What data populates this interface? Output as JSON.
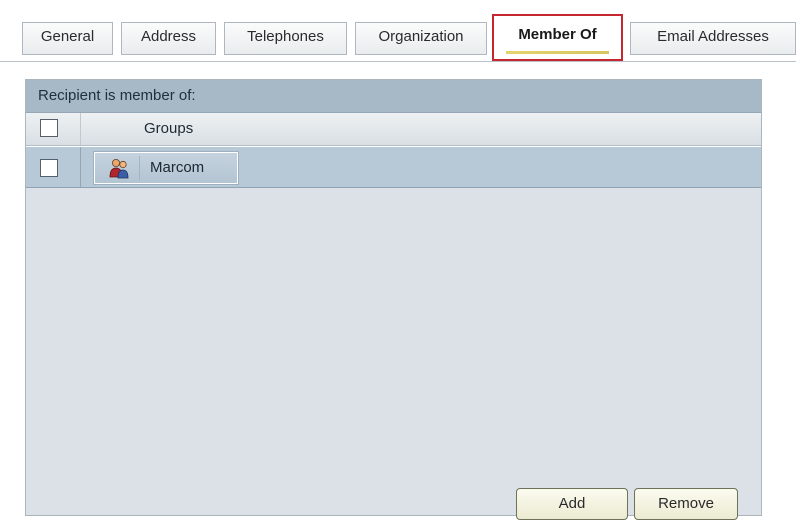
{
  "tabs": [
    {
      "label": "General",
      "active": false
    },
    {
      "label": "Address",
      "active": false
    },
    {
      "label": "Telephones",
      "active": false
    },
    {
      "label": "Organization",
      "active": false
    },
    {
      "label": "Member Of",
      "active": true
    },
    {
      "label": "Email Addresses",
      "active": false
    }
  ],
  "membership": {
    "caption": "Recipient is member of:",
    "column_header": "Groups",
    "rows": [
      {
        "name": "Marcom",
        "icon": "group-icon",
        "checked": false
      }
    ]
  },
  "buttons": {
    "add": "Add",
    "remove": "Remove"
  },
  "colors": {
    "active_tab_border": "#c6262e",
    "caption_bar": "#a7b8c6",
    "selected_row": "#b7c8d6"
  }
}
